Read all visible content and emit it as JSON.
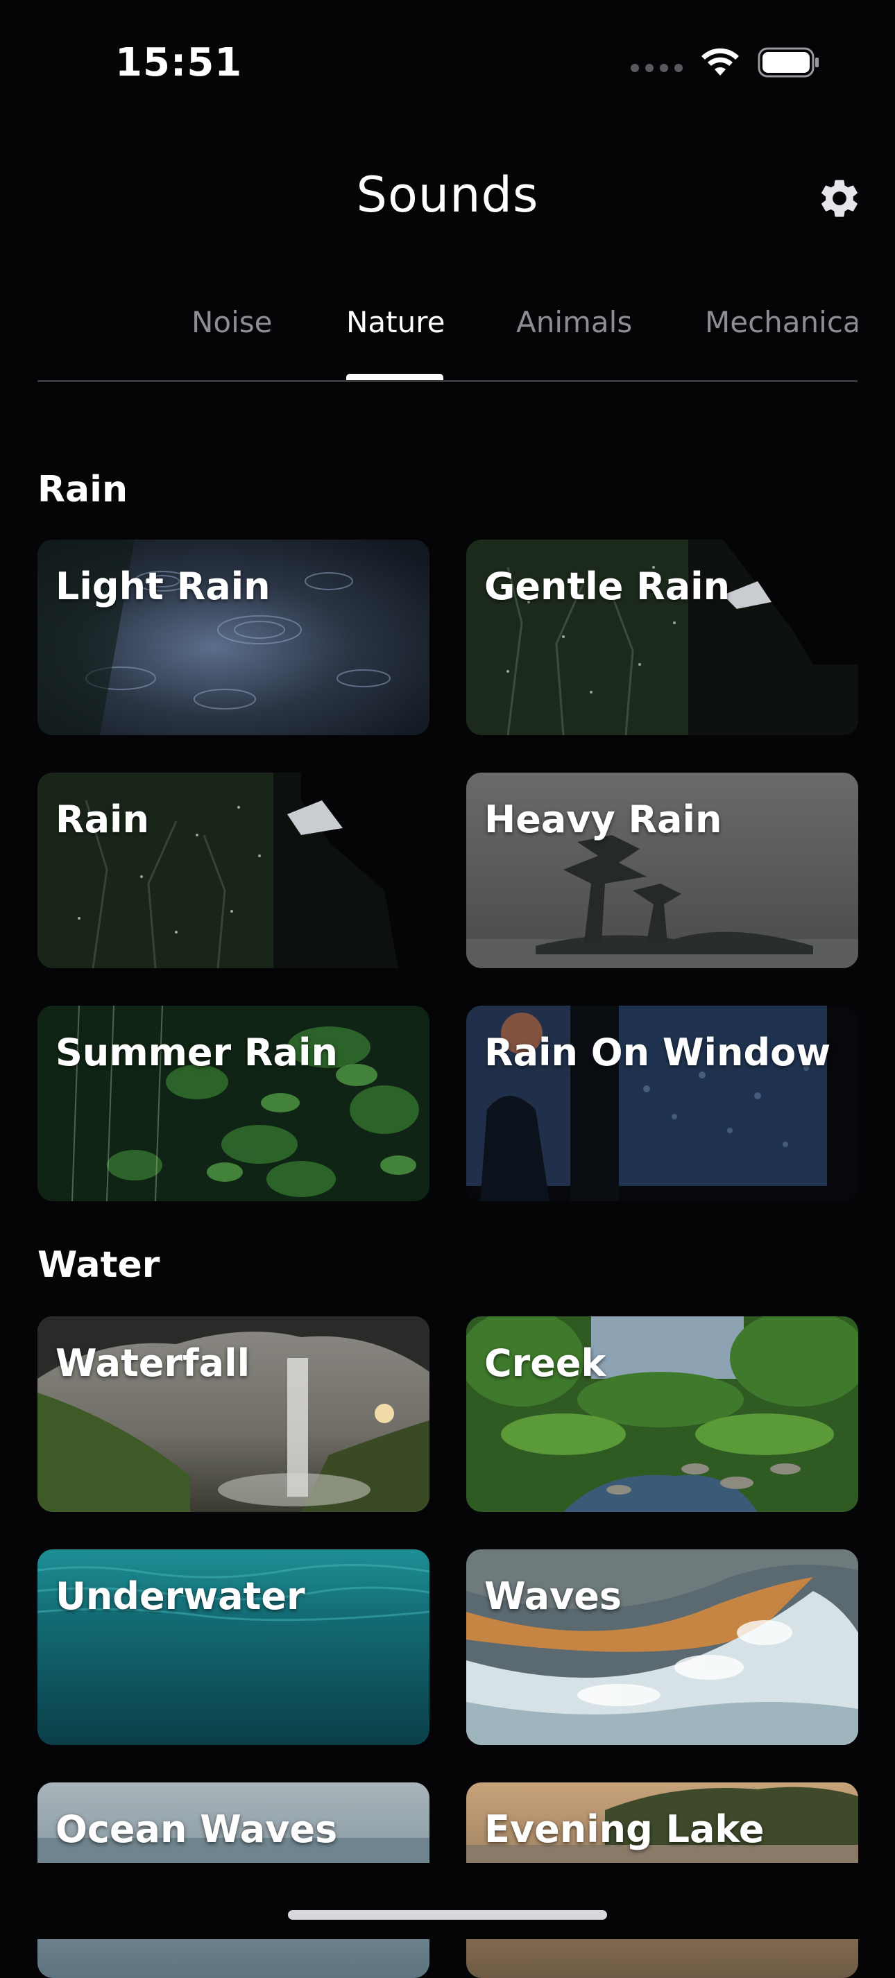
{
  "status_bar": {
    "time": "15:51"
  },
  "header": {
    "title": "Sounds",
    "settings_icon": "gear-icon"
  },
  "tabs": [
    {
      "label": "Noise",
      "active": false
    },
    {
      "label": "Nature",
      "active": true
    },
    {
      "label": "Animals",
      "active": false
    },
    {
      "label": "Mechanica",
      "active": false
    }
  ],
  "sections": [
    {
      "title": "Rain",
      "items": [
        {
          "label": "Light Rain"
        },
        {
          "label": "Gentle Rain"
        },
        {
          "label": "Rain"
        },
        {
          "label": "Heavy Rain"
        },
        {
          "label": "Summer Rain"
        },
        {
          "label": "Rain On Window"
        }
      ]
    },
    {
      "title": "Water",
      "items": [
        {
          "label": "Waterfall"
        },
        {
          "label": "Creek"
        },
        {
          "label": "Underwater"
        },
        {
          "label": "Waves"
        },
        {
          "label": "Ocean Waves"
        },
        {
          "label": "Evening Lake"
        }
      ]
    }
  ],
  "colors": {
    "background": "#050507",
    "tab_inactive": "#8d8d93",
    "tab_active": "#ffffff",
    "divider": "#3a3a3e"
  }
}
